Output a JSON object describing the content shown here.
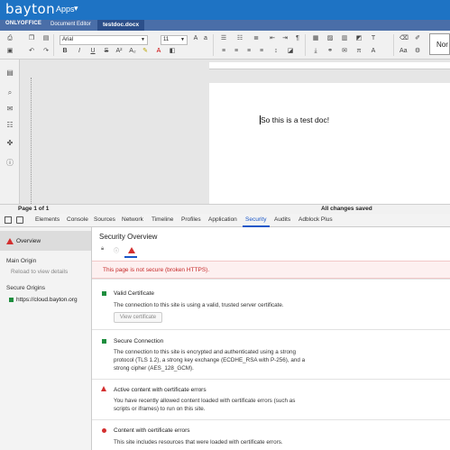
{
  "brand": {
    "logo": "bayton",
    "apps_label": "Apps",
    "caret": "▾"
  },
  "editor_bar": {
    "logo": "ONLYOFFICE",
    "product": "Document Editor",
    "file_name": "testdoc.docx"
  },
  "toolbar": {
    "font_name": "Arial",
    "font_size": "11",
    "bold": "B",
    "italic": "I",
    "underline": "U",
    "strike": "S",
    "superscript": "A²",
    "subscript": "A₂",
    "style_preview": "Nor"
  },
  "document": {
    "text": "So this is a test doc!"
  },
  "status": {
    "page": "Page 1 of 1",
    "saved": "All changes saved"
  },
  "devtools": {
    "tabs": [
      "Elements",
      "Console",
      "Sources",
      "Network",
      "Timeline",
      "Profiles",
      "Application",
      "Security",
      "Audits",
      "Adblock Plus"
    ],
    "active_tab": "Security"
  },
  "security": {
    "sidebar": {
      "overview": "Overview",
      "main_origin": "Main Origin",
      "reload": "Reload to view details",
      "secure_origins": "Secure Origins",
      "origin": "https://cloud.bayton.org"
    },
    "title": "Security Overview",
    "banner": "This page is not secure (broken HTTPS).",
    "sections": [
      {
        "heading": "Valid Certificate",
        "body": "The connection to this site is using a valid, trusted server certificate.",
        "button": "View certificate"
      },
      {
        "heading": "Secure Connection",
        "body": "The connection to this site is encrypted and authenticated using a strong protocol (TLS 1.2), a strong key exchange (ECDHE_RSA with P-256), and a strong cipher (AES_128_GCM)."
      },
      {
        "heading": "Active content with certificate errors",
        "body": "You have recently allowed content loaded with certificate errors (such as scripts or iframes) to run on this site."
      },
      {
        "heading": "Content with certificate errors",
        "body": "This site includes resources that were loaded with certificate errors."
      }
    ]
  },
  "colors": {
    "brand": "#1e73c4",
    "editor_bar": "#4a6ea8",
    "danger": "#d32f2f",
    "secure": "#1e8e3e",
    "link_active": "#1a57c8"
  }
}
